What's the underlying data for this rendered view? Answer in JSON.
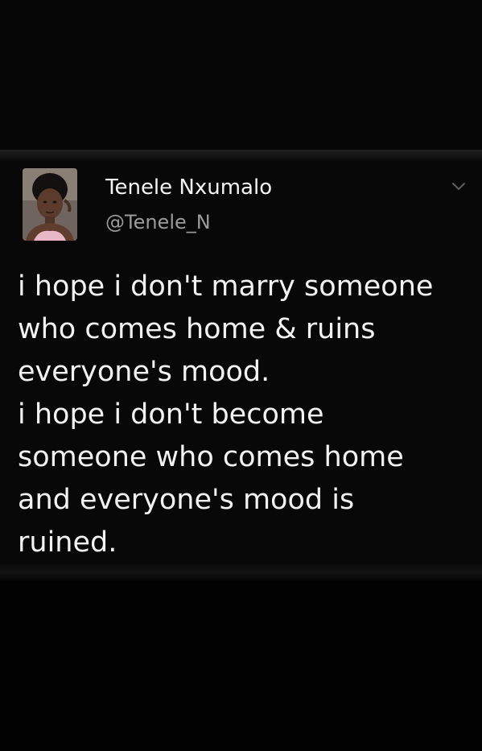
{
  "tweet": {
    "author": {
      "display_name": "Tenele Nxumalo",
      "handle": "@Tenele_N"
    },
    "menu_icon": "chevron-down-icon",
    "text_lines": [
      "i hope i don't marry someone",
      "who comes home & ruins",
      "everyone's mood.",
      "i hope i don't become",
      "someone who comes home",
      "and everyone's mood is",
      "ruined."
    ]
  },
  "colors": {
    "background": "#000000",
    "text": "#f2f2f2",
    "handle": "#9a9a9a"
  }
}
